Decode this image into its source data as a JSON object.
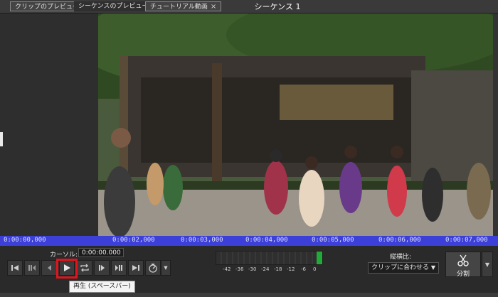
{
  "tabs": [
    {
      "label": "クリップのプレビュー"
    },
    {
      "label": "シーケンスのプレビュー"
    },
    {
      "label": "チュートリアル動画"
    }
  ],
  "tab_close_glyph": "×",
  "sequence_title": "シーケンス 1",
  "timeline": {
    "ticks": [
      "0:00:00,000",
      "0:00:02,000",
      "0:00:03,000",
      "0:00:04,000",
      "0:00:05,000",
      "0:00:06,000",
      "0:00:07,000"
    ]
  },
  "cursor": {
    "label": "カーソル:",
    "value": "0:00:00.000"
  },
  "transport": {
    "buttons": [
      "go-to-start",
      "previous-edit-point",
      "step-back",
      "play",
      "loop",
      "step-forward",
      "next-edit-point",
      "go-to-end",
      "playback-speed"
    ],
    "dropdown_glyph": "▼"
  },
  "tooltip": "再生 (スペースバー)",
  "audio_meter": {
    "scale": [
      "-42",
      "-36",
      "-30",
      "-24",
      "-18",
      "-12",
      "-6",
      "0"
    ],
    "level_color": "#25a83a"
  },
  "aspect": {
    "label": "縦横比:",
    "value": "クリップに合わせる",
    "arrow": "▼"
  },
  "split": {
    "label": "分割",
    "icon": "scissors-icon"
  },
  "colors": {
    "timeline": "#3c3fd8",
    "highlight": "#e0141c",
    "meter": "#25a83a"
  }
}
